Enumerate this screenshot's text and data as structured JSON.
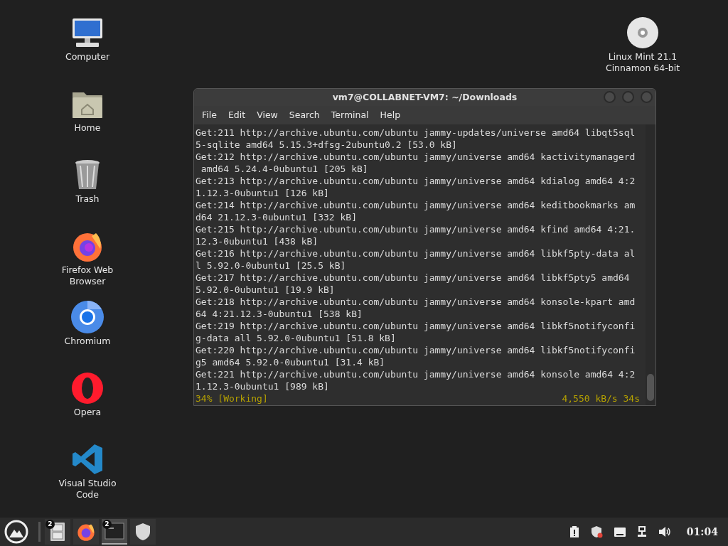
{
  "desktop_icons": [
    {
      "label": "Computer",
      "kind": "computer"
    },
    {
      "label": "Home",
      "kind": "home"
    },
    {
      "label": "Trash",
      "kind": "trash"
    },
    {
      "label": "Firefox Web Browser",
      "kind": "firefox"
    },
    {
      "label": "Chromium",
      "kind": "chromium"
    },
    {
      "label": "Opera",
      "kind": "opera"
    },
    {
      "label": "Visual Studio Code",
      "kind": "vscode"
    }
  ],
  "desktop_icons_right": [
    {
      "label": "Linux Mint 21.1 Cinnamon 64-bit",
      "kind": "disc"
    }
  ],
  "terminal": {
    "title": "vm7@COLLABNET-VM7: ~/Downloads",
    "menu": [
      "File",
      "Edit",
      "View",
      "Search",
      "Terminal",
      "Help"
    ],
    "lines": [
      "Get:211 http://archive.ubuntu.com/ubuntu jammy-updates/universe amd64 libqt5sql",
      "5-sqlite amd64 5.15.3+dfsg-2ubuntu0.2 [53.0 kB]",
      "Get:212 http://archive.ubuntu.com/ubuntu jammy/universe amd64 kactivitymanagerd",
      " amd64 5.24.4-0ubuntu1 [205 kB]",
      "Get:213 http://archive.ubuntu.com/ubuntu jammy/universe amd64 kdialog amd64 4:2",
      "1.12.3-0ubuntu1 [126 kB]",
      "Get:214 http://archive.ubuntu.com/ubuntu jammy/universe amd64 keditbookmarks am",
      "d64 21.12.3-0ubuntu1 [332 kB]",
      "Get:215 http://archive.ubuntu.com/ubuntu jammy/universe amd64 kfind amd64 4:21.",
      "12.3-0ubuntu1 [438 kB]",
      "Get:216 http://archive.ubuntu.com/ubuntu jammy/universe amd64 libkf5pty-data al",
      "l 5.92.0-0ubuntu1 [25.5 kB]",
      "Get:217 http://archive.ubuntu.com/ubuntu jammy/universe amd64 libkf5pty5 amd64",
      "5.92.0-0ubuntu1 [19.9 kB]",
      "Get:218 http://archive.ubuntu.com/ubuntu jammy/universe amd64 konsole-kpart amd",
      "64 4:21.12.3-0ubuntu1 [538 kB]",
      "Get:219 http://archive.ubuntu.com/ubuntu jammy/universe amd64 libkf5notifyconfi",
      "g-data all 5.92.0-0ubuntu1 [51.8 kB]",
      "Get:220 http://archive.ubuntu.com/ubuntu jammy/universe amd64 libkf5notifyconfi",
      "g5 amd64 5.92.0-0ubuntu1 [31.4 kB]",
      "Get:221 http://archive.ubuntu.com/ubuntu jammy/universe amd64 konsole amd64 4:2",
      "1.12.3-0ubuntu1 [989 kB]"
    ],
    "status_left": "34% [Working]",
    "status_right": "4,550 kB/s 34s"
  },
  "taskbar": {
    "items": [
      {
        "kind": "files",
        "badge": "2",
        "active": false
      },
      {
        "kind": "firefox",
        "active": false
      },
      {
        "kind": "terminal",
        "badge": "2",
        "active": true
      },
      {
        "kind": "shield",
        "active": false
      }
    ],
    "tray": [
      {
        "kind": "clipboard"
      },
      {
        "kind": "shield-alert"
      },
      {
        "kind": "keyboard"
      },
      {
        "kind": "network"
      },
      {
        "kind": "volume"
      }
    ],
    "clock": "01:04"
  }
}
